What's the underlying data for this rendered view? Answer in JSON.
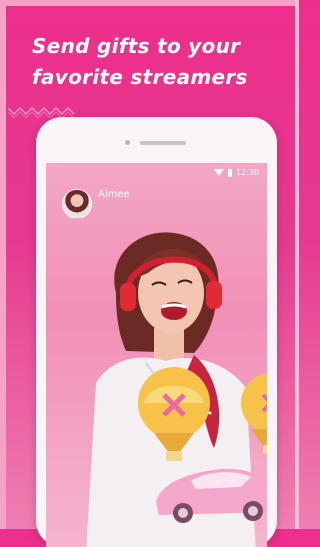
{
  "promo": {
    "headline_line1": "Send gifts to your",
    "headline_line2": "favorite streamers"
  },
  "phone": {
    "status_bar": {
      "time": "12:30"
    },
    "streamer": {
      "name": "Aimee",
      "subtitle": ""
    }
  },
  "colors": {
    "brand_pink": "#ec2f8c",
    "screen_pink": "#f18fb6"
  },
  "icons": [
    "wifi-icon",
    "battery-icon",
    "gift-balloon-icon",
    "gift-car-icon",
    "headphones-icon",
    "microphone-icon"
  ]
}
